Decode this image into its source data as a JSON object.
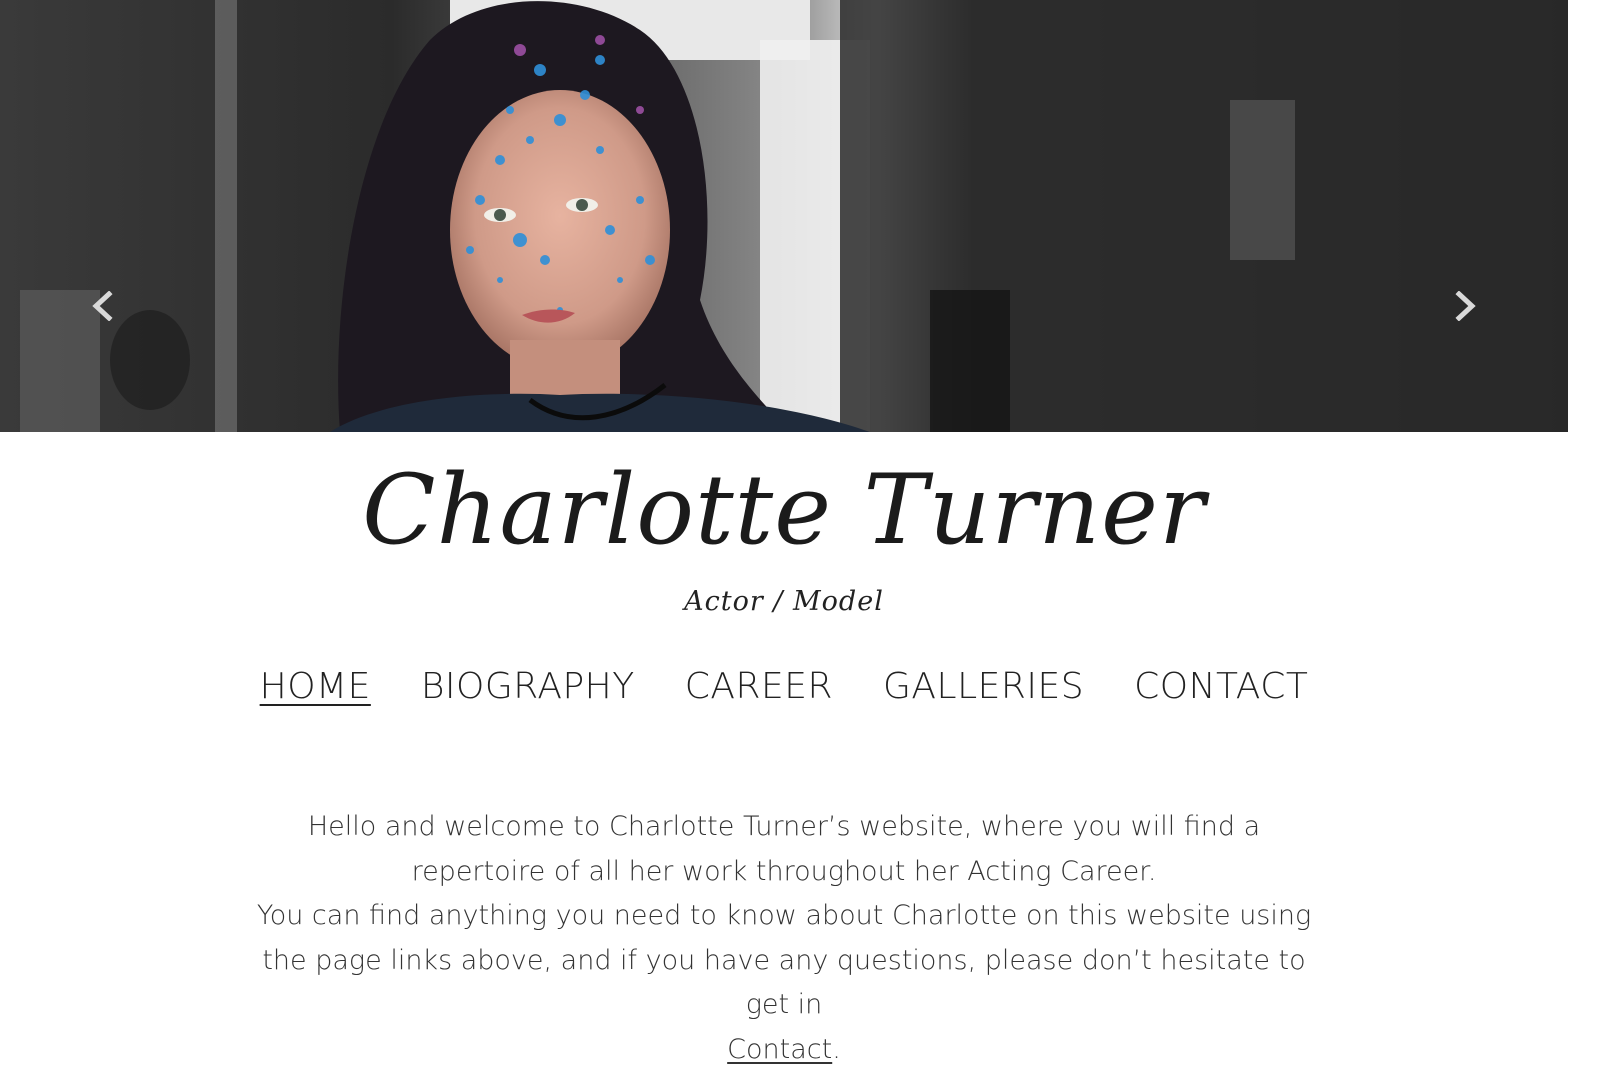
{
  "hero": {
    "prev_icon": "chevron-left-icon",
    "next_icon": "chevron-right-icon"
  },
  "site": {
    "title": "Charlotte Turner",
    "subtitle": "Actor / Model"
  },
  "nav": {
    "items": [
      {
        "label": "HOME",
        "active": true
      },
      {
        "label": "BIOGRAPHY",
        "active": false
      },
      {
        "label": "CAREER",
        "active": false
      },
      {
        "label": "GALLERIES",
        "active": false
      },
      {
        "label": "CONTACT",
        "active": false
      }
    ]
  },
  "welcome": {
    "paragraph1": "Hello and welcome to Charlotte Turner’s website, where you will find a repertoire of all her work throughout her Acting Career.",
    "paragraph2": "You can find anything you need to know about Charlotte on this website using the page links above, and if you have any questions, please don’t hesitate to get in",
    "contact_link": "Contact",
    "trailing": "."
  },
  "colors": {
    "text": "#222222",
    "body_text": "#333333",
    "background": "#ffffff"
  }
}
